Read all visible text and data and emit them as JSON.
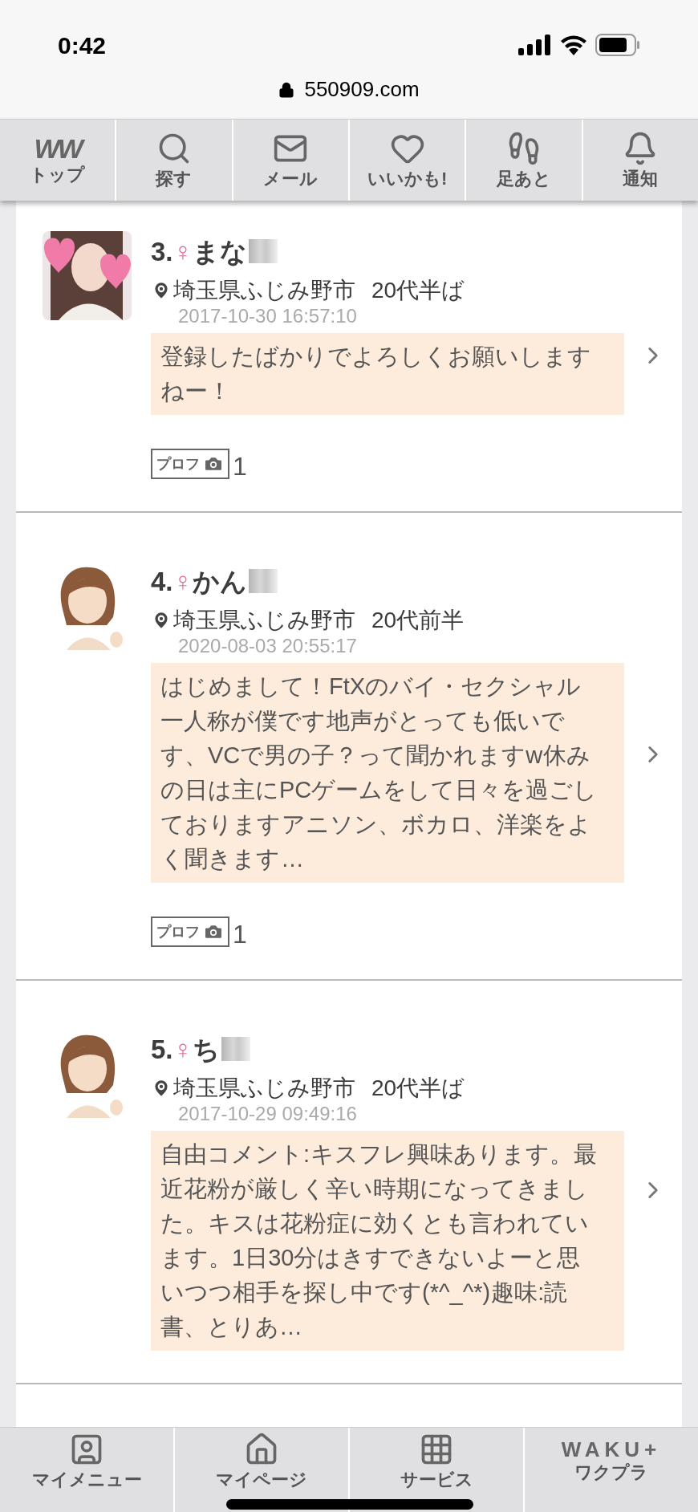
{
  "status_bar": {
    "time": "0:42",
    "url": "550909.com"
  },
  "top_nav": [
    {
      "kind": "logo",
      "logo": "WW",
      "label": "トップ"
    },
    {
      "kind": "search",
      "label": "探す"
    },
    {
      "kind": "mail",
      "label": "メール"
    },
    {
      "kind": "heart",
      "label": "いいかも!"
    },
    {
      "kind": "footprints",
      "label": "足あと"
    },
    {
      "kind": "bell",
      "label": "通知"
    }
  ],
  "members": [
    {
      "rank": "3.",
      "gender": "♀",
      "name": "まな",
      "location": "埼玉県ふじみ野市",
      "age": "20代半ば",
      "date": "2017-10-30 16:57:10",
      "comment": "登録したばかりでよろしくお願いしますねー！",
      "badge": {
        "label": "プロフ",
        "count": "1"
      }
    },
    {
      "rank": "4.",
      "gender": "♀",
      "name": "かん",
      "avatar": {
        "kind": "illustration"
      },
      "location": "埼玉県ふじみ野市",
      "age": "20代前半",
      "date": "2020-08-03 20:55:17",
      "comment": "はじめまして！ FtXのバイ・セクシャル一人称が僕です 地声がとっても低いです、VCで男の子？って聞かれますw 休みの日は主にPCゲームをして日々を過ごしております アニソン、ボカロ、洋楽をよく聞きます …",
      "badge": {
        "label": "プロフ",
        "count": "1"
      }
    },
    {
      "rank": "5.",
      "gender": "♀",
      "name": "ち",
      "avatar": {
        "kind": "illustration"
      },
      "location": "埼玉県ふじみ野市",
      "age": "20代半ば",
      "date": "2017-10-29 09:49:16",
      "comment": "自由コメント: キスフレ興味あります。 最近花粉が厳しく辛い時期になってきました。キスは花粉症に効くとも言われています。1日30分はきすできないよーと思いつつ相手を探し中です(*^_^*) 趣味:読書、とりあ…"
    }
  ],
  "bottom_nav": [
    {
      "kind": "person",
      "label": "マイメニュー"
    },
    {
      "kind": "home",
      "label": "マイページ"
    },
    {
      "kind": "grid",
      "label": "サービス"
    },
    {
      "kind": "logo",
      "logo": "WAKU+",
      "label": "ワクプラ"
    }
  ]
}
